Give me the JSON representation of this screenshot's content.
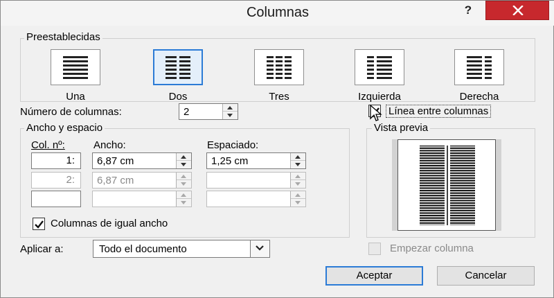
{
  "dialog": {
    "title": "Columnas",
    "help_label": "?"
  },
  "presets": {
    "group_label": "Preestablecidas",
    "items": [
      {
        "label": "Una",
        "icon": "one-column-icon",
        "selected": false
      },
      {
        "label": "Dos",
        "icon": "two-columns-icon",
        "selected": true
      },
      {
        "label": "Tres",
        "icon": "three-columns-icon",
        "selected": false
      },
      {
        "label": "Izquierda",
        "icon": "left-column-icon",
        "selected": false
      },
      {
        "label": "Derecha",
        "icon": "right-column-icon",
        "selected": false
      }
    ]
  },
  "num_columns": {
    "label": "Número de columnas:",
    "value": "2"
  },
  "line_between": {
    "label": "Línea entre columnas",
    "checked": true
  },
  "width_spacing": {
    "group_label": "Ancho y espacio",
    "headers": {
      "col": "Col. nº:",
      "width": "Ancho:",
      "spacing": "Espaciado:"
    },
    "rows": [
      {
        "col": "1:",
        "width": "6,87 cm",
        "spacing": "1,25 cm",
        "enabled": true
      },
      {
        "col": "2:",
        "width": "6,87 cm",
        "spacing": "",
        "enabled": false
      },
      {
        "col": "",
        "width": "",
        "spacing": "",
        "enabled": false
      }
    ],
    "equal_width": {
      "label": "Columnas de igual ancho",
      "checked": true
    }
  },
  "preview": {
    "group_label": "Vista previa"
  },
  "apply_to": {
    "label": "Aplicar a:",
    "value": "Todo el documento"
  },
  "start_column": {
    "label": "Empezar columna",
    "checked": false,
    "enabled": false
  },
  "buttons": {
    "ok": "Aceptar",
    "cancel": "Cancelar"
  },
  "colors": {
    "accent": "#2b7bd6",
    "close_red": "#c7282d"
  }
}
